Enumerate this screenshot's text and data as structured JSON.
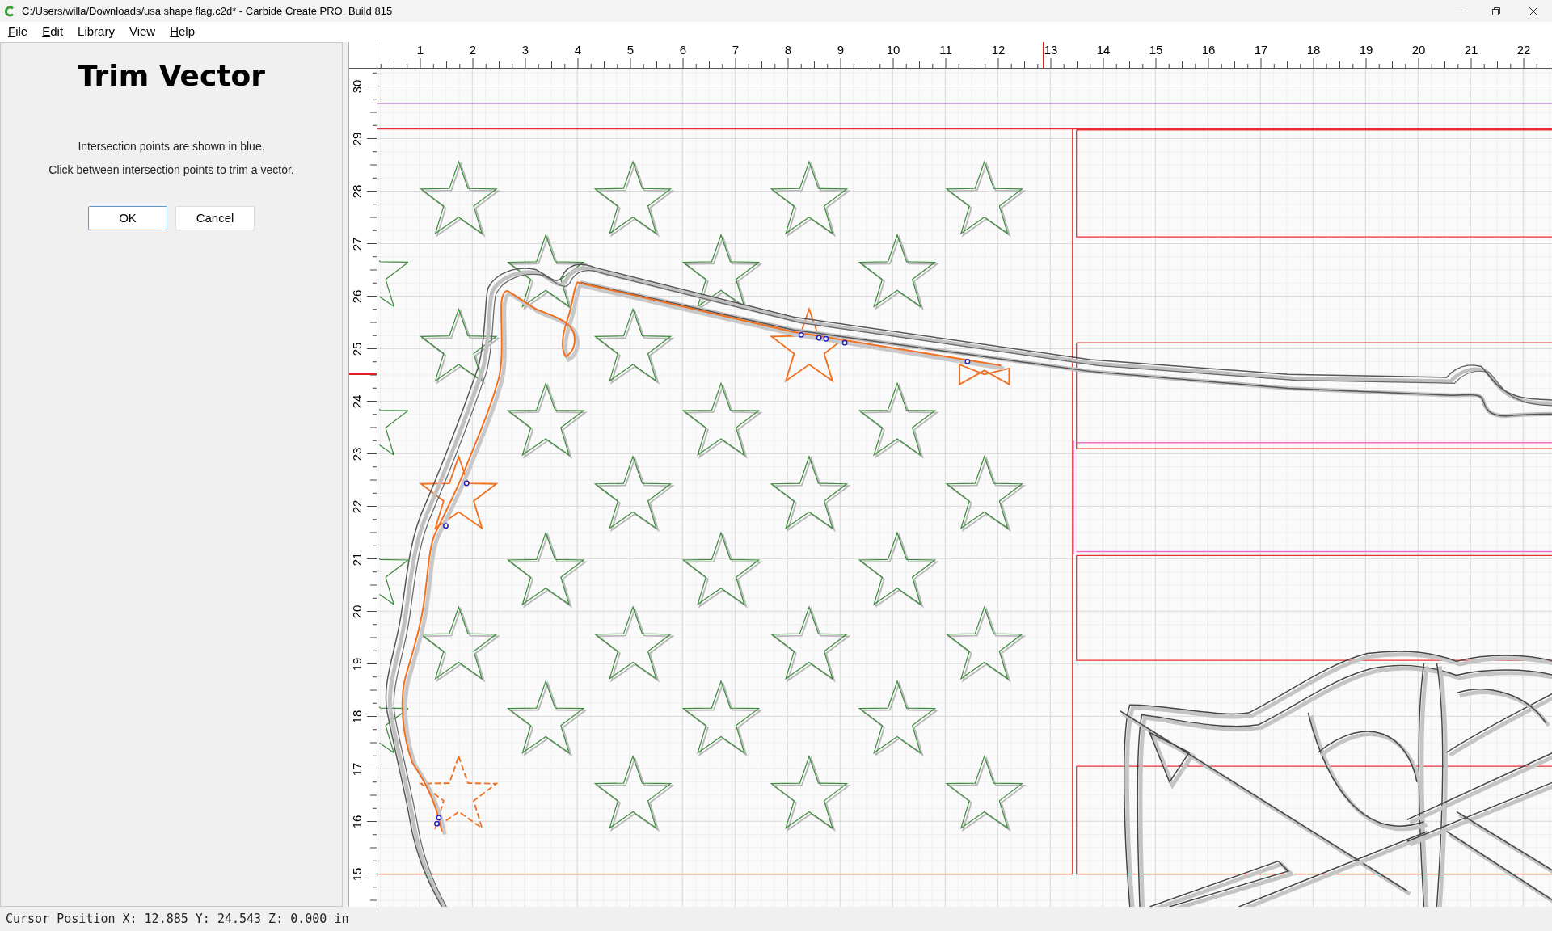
{
  "window": {
    "title": "C:/Users/willa/Downloads/usa shape flag.c2d* - Carbide Create PRO, Build 815"
  },
  "menu": [
    {
      "label": "File",
      "mnemonic": true
    },
    {
      "label": "Edit",
      "mnemonic": true
    },
    {
      "label": "Library",
      "mnemonic": false
    },
    {
      "label": "View",
      "mnemonic": false
    },
    {
      "label": "Help",
      "mnemonic": true
    }
  ],
  "panel": {
    "title": "Trim Vector",
    "instructions": [
      "Intersection points are shown in blue.",
      "Click between intersection points to trim a vector."
    ],
    "buttons": [
      {
        "label": "OK",
        "default": true
      },
      {
        "label": "Cancel",
        "default": false
      }
    ]
  },
  "rulers": {
    "x_labels": [
      "1",
      "2",
      "3",
      "4",
      "5",
      "6",
      "7",
      "8",
      "9",
      "10",
      "11",
      "12",
      "13",
      "14",
      "15",
      "16",
      "17",
      "18",
      "19",
      "20",
      "21",
      "22"
    ],
    "y_labels": [
      "30",
      "29",
      "28",
      "27",
      "26",
      "25",
      "24",
      "23",
      "22",
      "21",
      "20",
      "19",
      "18",
      "17",
      "16",
      "15"
    ]
  },
  "status_bar": {
    "text": "Cursor Position X: 12.885 Y: 24.543 Z: 0.000 in"
  }
}
